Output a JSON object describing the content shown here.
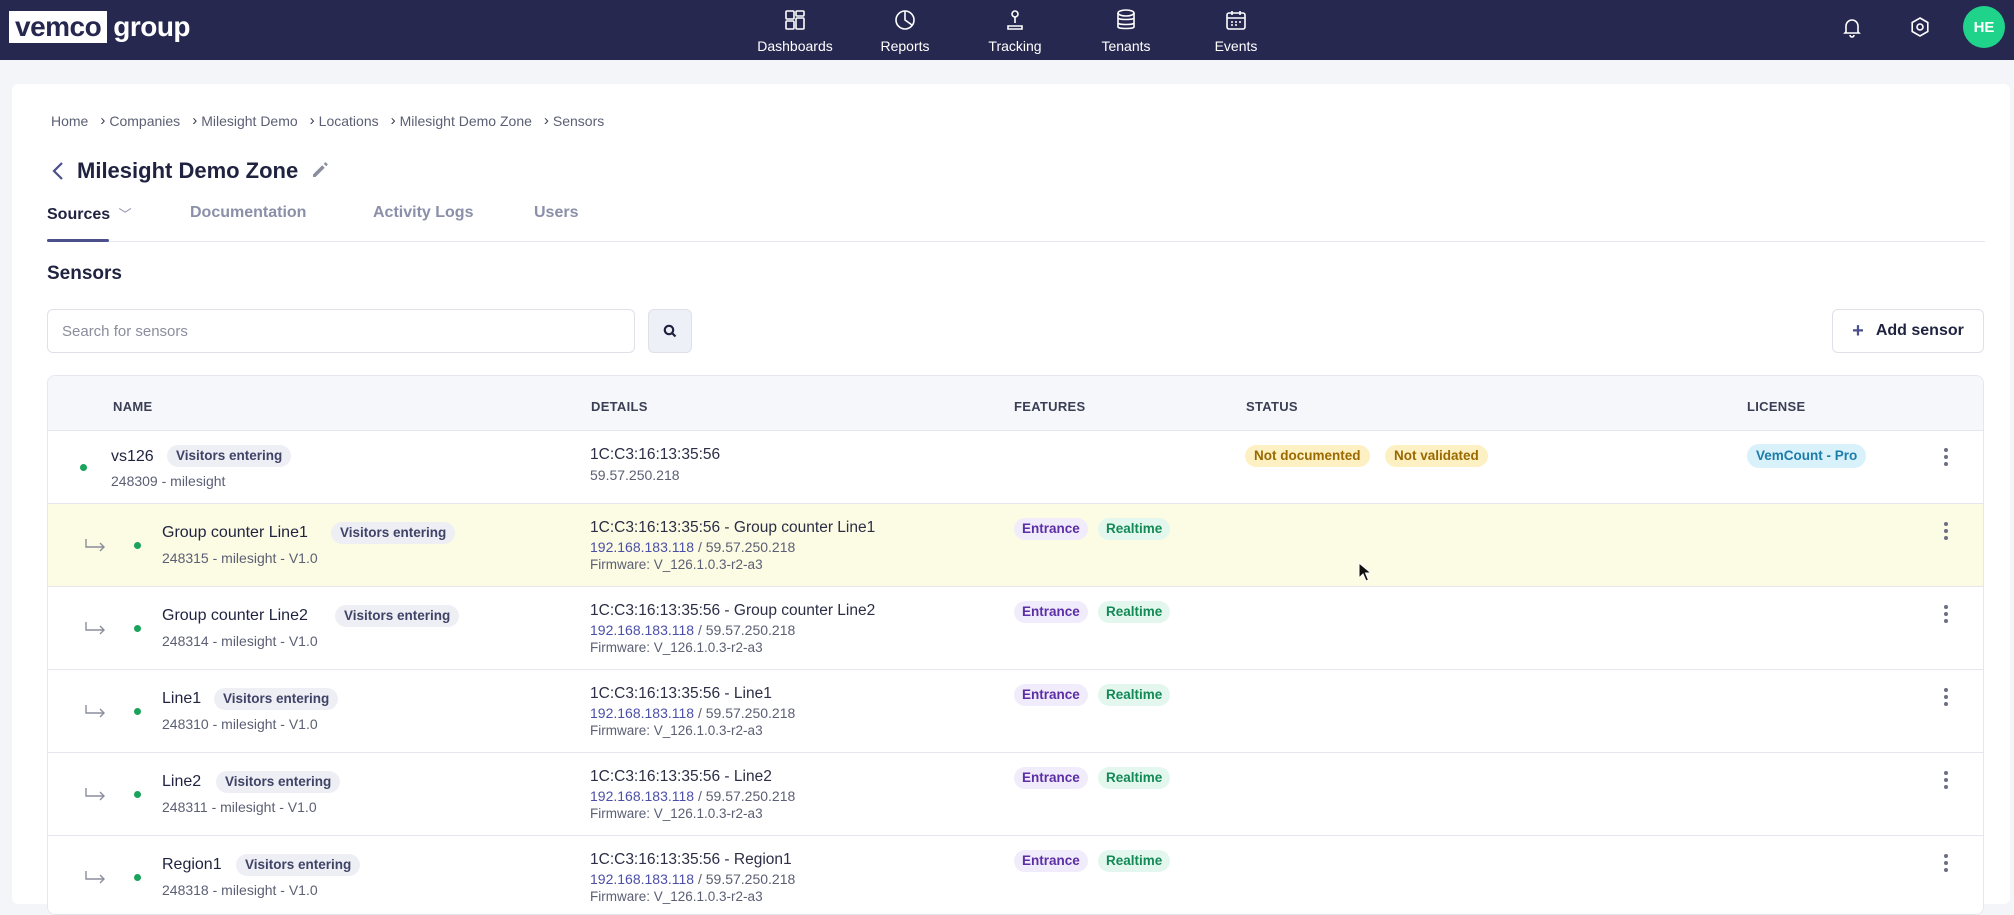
{
  "app": {
    "logo_boxed": "vemco",
    "logo_text": "group",
    "user_initials": "HE"
  },
  "nav": {
    "dashboards": "Dashboards",
    "reports": "Reports",
    "tracking": "Tracking",
    "tenants": "Tenants",
    "events": "Events"
  },
  "breadcrumb": [
    "Home",
    "Companies",
    "Milesight Demo",
    "Locations",
    "Milesight Demo Zone",
    "Sensors"
  ],
  "page": {
    "title": "Milesight Demo Zone",
    "section_title": "Sensors"
  },
  "tabs": {
    "sources": "Sources",
    "documentation": "Documentation",
    "activity_logs": "Activity Logs",
    "users": "Users"
  },
  "search": {
    "placeholder": "Search for sensors"
  },
  "actions": {
    "add_sensor": "Add sensor",
    "add_icon": "plus-icon"
  },
  "table": {
    "headers": {
      "name": "NAME",
      "details": "DETAILS",
      "features": "FEATURES",
      "status": "STATUS",
      "license": "LICENSE"
    },
    "rows": [
      {
        "name": "vs126",
        "tag": "Visitors entering",
        "sub": "248309 - milesight",
        "detail1": "1C:C3:16:13:35:56",
        "detail2": "59.57.250.218",
        "status": [
          "Not documented",
          "Not validated"
        ],
        "license": "VemCount - Pro"
      },
      {
        "name": "Group counter Line1",
        "tag": "Visitors entering",
        "sub": "248315 - milesight - V1.0",
        "detail1": "1C:C3:16:13:35:56 - Group counter Line1",
        "ip": "192.168.183.118",
        "ip_rest": " / 59.57.250.218",
        "firmware": "Firmware: V_126.1.0.3-r2-a3",
        "features": [
          "Entrance",
          "Realtime"
        ]
      },
      {
        "name": "Group counter Line2",
        "tag": "Visitors entering",
        "sub": "248314 - milesight - V1.0",
        "detail1": "1C:C3:16:13:35:56 - Group counter Line2",
        "ip": "192.168.183.118",
        "ip_rest": " / 59.57.250.218",
        "firmware": "Firmware: V_126.1.0.3-r2-a3",
        "features": [
          "Entrance",
          "Realtime"
        ]
      },
      {
        "name": "Line1",
        "tag": "Visitors entering",
        "sub": "248310 - milesight - V1.0",
        "detail1": "1C:C3:16:13:35:56 - Line1",
        "ip": "192.168.183.118",
        "ip_rest": " / 59.57.250.218",
        "firmware": "Firmware: V_126.1.0.3-r2-a3",
        "features": [
          "Entrance",
          "Realtime"
        ]
      },
      {
        "name": "Line2",
        "tag": "Visitors entering",
        "sub": "248311 - milesight - V1.0",
        "detail1": "1C:C3:16:13:35:56 - Line2",
        "ip": "192.168.183.118",
        "ip_rest": " / 59.57.250.218",
        "firmware": "Firmware: V_126.1.0.3-r2-a3",
        "features": [
          "Entrance",
          "Realtime"
        ]
      },
      {
        "name": "Region1",
        "tag": "Visitors entering",
        "sub": "248318 - milesight - V1.0",
        "detail1": "1C:C3:16:13:35:56 - Region1",
        "ip": "192.168.183.118",
        "ip_rest": " / 59.57.250.218",
        "firmware": "Firmware: V_126.1.0.3-r2-a3",
        "features": [
          "Entrance",
          "Realtime"
        ]
      }
    ]
  },
  "colors": {
    "nav_bg": "#272850",
    "accent": "#4b4f8c",
    "highlight_row": "#fcfbe3",
    "status_dot": "#1aa35a",
    "avatar": "#1fd38a"
  }
}
